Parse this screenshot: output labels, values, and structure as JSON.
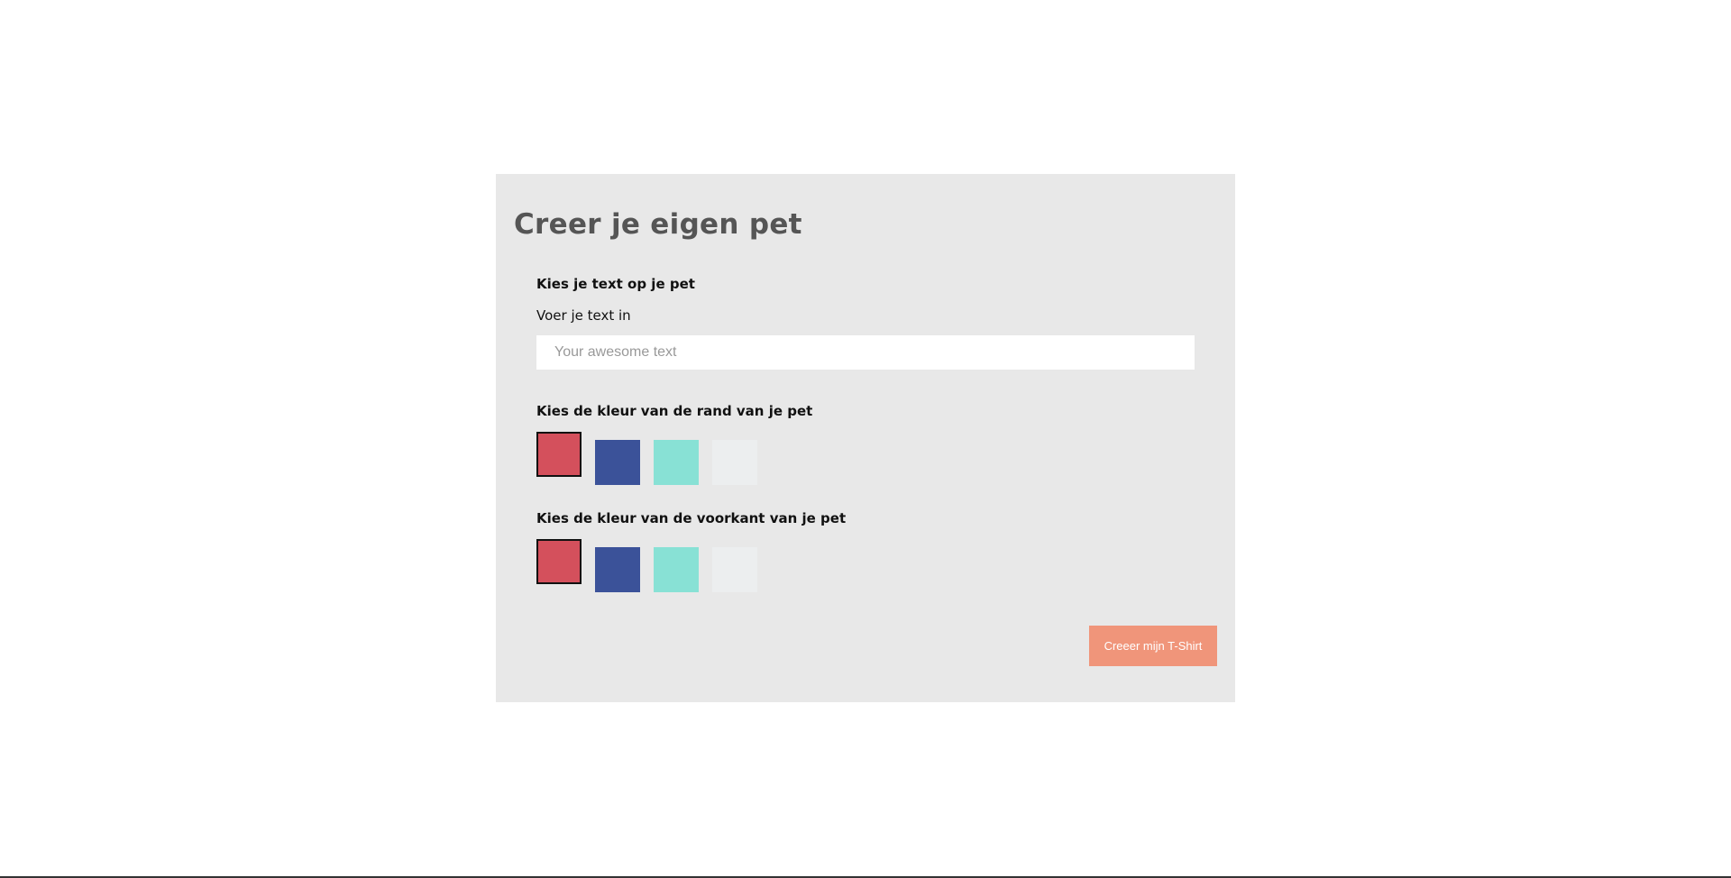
{
  "form": {
    "title": "Creer je eigen pet",
    "text_section": {
      "heading": "Kies je text op je pet",
      "label": "Voer je text in",
      "placeholder": "Your awesome text",
      "value": ""
    },
    "rim_color_section": {
      "heading": "Kies de kleur van de rand van je pet",
      "swatches": [
        {
          "name": "red",
          "color": "#d4505c",
          "selected": true
        },
        {
          "name": "blue",
          "color": "#3b5299",
          "selected": false
        },
        {
          "name": "turquoise",
          "color": "#88e1d5",
          "selected": false
        },
        {
          "name": "light-gray",
          "color": "#eceeef",
          "selected": false
        }
      ]
    },
    "front_color_section": {
      "heading": "Kies de kleur van de voorkant van je pet",
      "swatches": [
        {
          "name": "red",
          "color": "#d4505c",
          "selected": true
        },
        {
          "name": "blue",
          "color": "#3b5299",
          "selected": false
        },
        {
          "name": "turquoise",
          "color": "#88e1d5",
          "selected": false
        },
        {
          "name": "light-gray",
          "color": "#eceeef",
          "selected": false
        }
      ]
    },
    "submit_label": "Creeer mijn T-Shirt"
  },
  "colors": {
    "page_background": "#ffffff",
    "panel_background": "#e8e8e8",
    "title_color": "#555555",
    "button_background": "#f0957a",
    "button_text": "#ffffff"
  }
}
